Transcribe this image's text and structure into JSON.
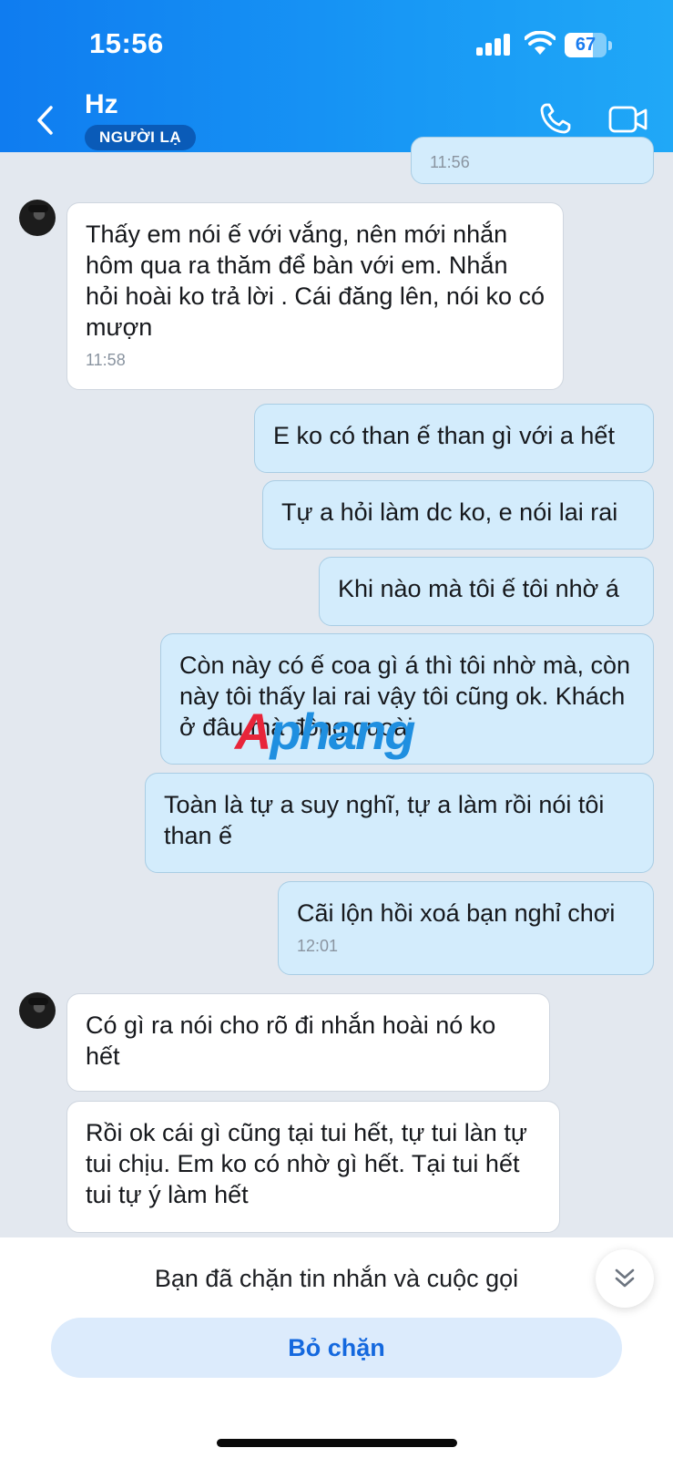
{
  "status_bar": {
    "time": "15:56",
    "battery": "67",
    "battery_level": 0.67
  },
  "header": {
    "contact_name": "Hz",
    "badge": "NGƯỜI LẠ"
  },
  "messages": [
    {
      "side": "out",
      "text": "",
      "time": "11:56"
    },
    {
      "side": "in",
      "text": "Thấy em nói ế với vắng, nên mới nhắn hôm qua ra thăm để bàn với em. Nhắn hỏi hoài ko trả lời . Cái đăng lên, nói ko có mượn",
      "time": "11:58"
    },
    {
      "side": "out",
      "text": "E ko có than ế than gì với a hết"
    },
    {
      "side": "out",
      "text": "Tự a hỏi làm dc ko, e nói lai rai"
    },
    {
      "side": "out",
      "text": "Khi nào mà tôi ế tôi nhờ á"
    },
    {
      "side": "out",
      "text": "Còn này có ế coa gì á thì tôi nhờ mà, còn này tôi thấy lai rai vậy tôi cũng ok. Khách ở đâu mà đông quoài"
    },
    {
      "side": "out",
      "text": "Toàn là tự a suy nghĩ, tự a làm rồi nói tôi than ế"
    },
    {
      "side": "out",
      "text": "Cãi lộn hồi xoá bạn nghỉ chơi",
      "time": "12:01"
    },
    {
      "side": "in",
      "text": "Có gì ra nói cho rõ đi nhắn hoài nó ko hết"
    },
    {
      "side": "in",
      "text": "Rồi ok cái gì cũng tại tui hết, tự tui làn tự tui chịu. Em ko có nhờ gì hết. Tại tui hết tui tự ý làm hết"
    }
  ],
  "watermark": {
    "part1": "A",
    "part2": "phang"
  },
  "footer": {
    "blocked_text": "Bạn đã chặn tin nhắn và cuộc gọi",
    "unblock_label": "Bỏ chặn"
  },
  "icons": {
    "back": "chevron-left-icon",
    "call": "phone-icon",
    "video": "video-camera-icon",
    "scroll": "double-chevron-down-icon",
    "signal": "signal-icon",
    "wifi": "wifi-icon"
  }
}
